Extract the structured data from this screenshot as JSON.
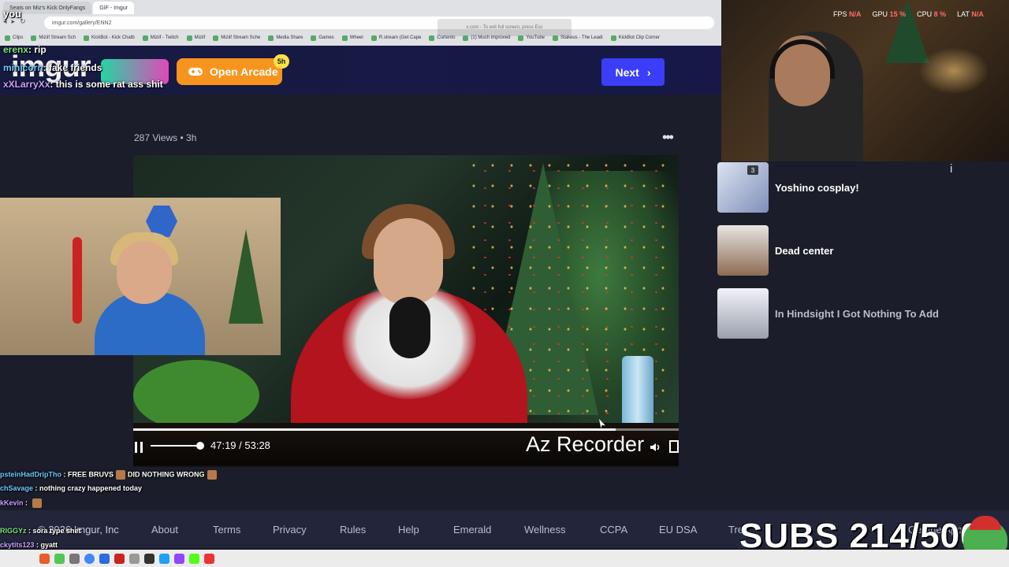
{
  "browser": {
    "tabs": [
      {
        "label": "Seats on Miz's Kick OnlyFangs",
        "active": false
      },
      {
        "label": "GIF - Imgur",
        "active": true
      }
    ],
    "url": "imgur.com/gallery/ENN2",
    "fullscreen_hint": "x.com - To exit full screen, press Esc",
    "bookmarks": [
      "Clips",
      "Miziif Stream Sch",
      "KickBot - Kick Chatb",
      "Miziif - Twitch",
      "Miziif",
      "Miziif Stream Sche",
      "Media Share",
      "Games",
      "Wheel",
      "R.stream (Get Cape",
      "Curtento",
      "(1) Much improved",
      "YouTube",
      "Stakeus - The Leadi",
      "KickBot Clip Corner"
    ]
  },
  "header": {
    "logo": "imgur",
    "arcade_label": "Open Arcade",
    "arcade_badge": "5h",
    "next_label": "Next"
  },
  "post": {
    "views": "287 Views",
    "separator": "•",
    "age": "3h",
    "video": {
      "time": "47:19 / 53:28",
      "progress": 0.885,
      "volume": 0.9,
      "watermark": "Az Recorder"
    }
  },
  "sidebar": {
    "items": [
      {
        "title": "Yoshino cosplay!",
        "count": "3",
        "thumb_color": "#9aa6c6"
      },
      {
        "title": "Dead center",
        "thumb_color": "#b08a6e"
      },
      {
        "title": "In Hindsight I Got Nothing To Add",
        "thumb_color": "#c8ccd6"
      }
    ]
  },
  "hud": {
    "fps_label": "FPS",
    "fps": "N/A",
    "gpu_label": "GPU",
    "gpu": "15 %",
    "cpu_label": "CPU",
    "cpu": "8 %",
    "lat_label": "LAT",
    "lat": "N/A"
  },
  "chat_top": [
    {
      "user": "you",
      "text": ""
    },
    {
      "user": "erenx",
      "text": "rip"
    },
    {
      "user": "minicorn",
      "text": "fake friends"
    },
    {
      "user": "xXLarryXx",
      "text": "this is some rat ass shit"
    }
  ],
  "chat_bottom": [
    {
      "user": "psteinHadDripTho",
      "text": "FREE BRUVS",
      "text2": "DID NOTHING WRONG"
    },
    {
      "user": "chSavage",
      "text": "nothing crazy happened today"
    },
    {
      "user": "kKevin",
      "text": ""
    },
    {
      "user": "kKevin",
      "text": ""
    },
    {
      "user": "RIGGYz",
      "text": "sora type shet"
    },
    {
      "user": "ckytits123",
      "text": "gyatt"
    }
  ],
  "footer": {
    "copyright": "© 2026 Imgur, Inc",
    "links": [
      "About",
      "Terms",
      "Privacy",
      "Rules",
      "Help",
      "Emerald",
      "Wellness",
      "CCPA",
      "EU DSA",
      "Tre"
    ],
    "get_app": "Get the App"
  },
  "subs": {
    "text": "SUBS 214/500"
  },
  "colors": {
    "next_button": "#3b3ef6",
    "arcade_button": "#f7941e",
    "page_bg": "#1b1d2a"
  }
}
